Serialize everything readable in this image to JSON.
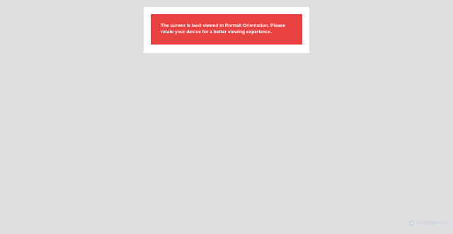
{
  "notice": {
    "message": "The screen is best viewed in Portrait Orientation. Please rotate your device for a better viewing experience."
  },
  "watermark": {
    "text": "ScanMalware",
    "icon": "scanmalware-logo-icon"
  },
  "colors": {
    "background": "#dedede",
    "card": "#ffffff",
    "banner": "#e84142",
    "banner_text": "#ffffff",
    "watermark": "#c9d4e4"
  }
}
